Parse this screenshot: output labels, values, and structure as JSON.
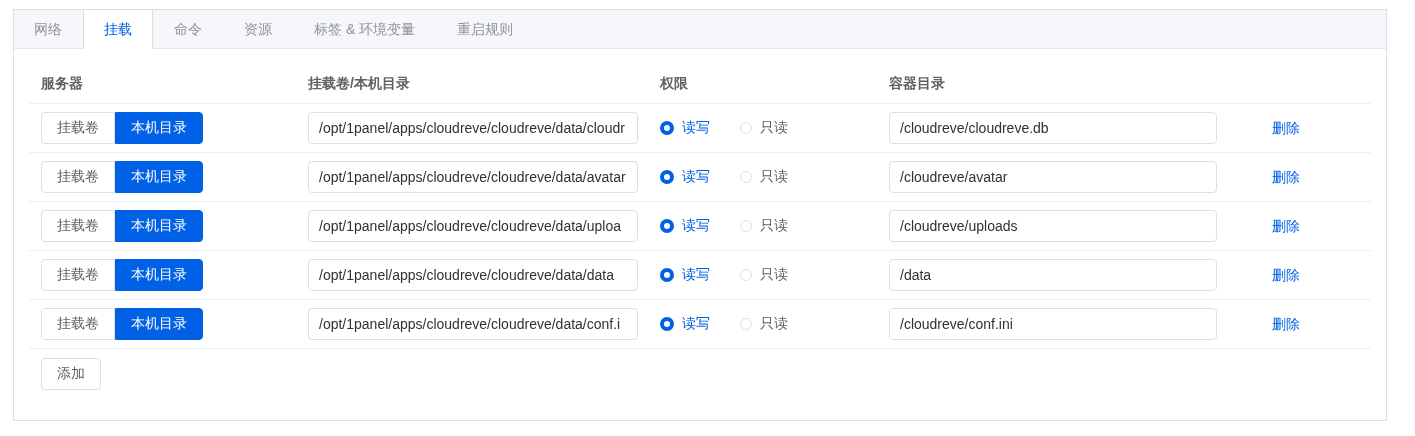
{
  "tabs": [
    {
      "label": "网络",
      "selected": false
    },
    {
      "label": "挂载",
      "selected": true
    },
    {
      "label": "命令",
      "selected": false
    },
    {
      "label": "资源",
      "selected": false
    },
    {
      "label": "标签 & 环境变量",
      "selected": false
    },
    {
      "label": "重启规则",
      "selected": false
    }
  ],
  "table": {
    "columns": [
      "服务器",
      "挂载卷/本机目录",
      "权限",
      "容器目录"
    ],
    "rows": [
      {
        "type_options": [
          {
            "label": "挂载卷",
            "selected": false
          },
          {
            "label": "本机目录",
            "selected": true
          }
        ],
        "source": "/opt/1panel/apps/cloudreve/cloudreve/data/cloudr",
        "permissions": [
          {
            "label": "读写",
            "selected": true
          },
          {
            "label": "只读",
            "selected": false
          }
        ],
        "target": "/cloudreve/cloudreve.db",
        "action": "删除"
      },
      {
        "type_options": [
          {
            "label": "挂载卷",
            "selected": false
          },
          {
            "label": "本机目录",
            "selected": true
          }
        ],
        "source": "/opt/1panel/apps/cloudreve/cloudreve/data/avatar",
        "permissions": [
          {
            "label": "读写",
            "selected": true
          },
          {
            "label": "只读",
            "selected": false
          }
        ],
        "target": "/cloudreve/avatar",
        "action": "删除"
      },
      {
        "type_options": [
          {
            "label": "挂载卷",
            "selected": false
          },
          {
            "label": "本机目录",
            "selected": true
          }
        ],
        "source": "/opt/1panel/apps/cloudreve/cloudreve/data/uploa",
        "permissions": [
          {
            "label": "读写",
            "selected": true
          },
          {
            "label": "只读",
            "selected": false
          }
        ],
        "target": "/cloudreve/uploads",
        "action": "删除"
      },
      {
        "type_options": [
          {
            "label": "挂载卷",
            "selected": false
          },
          {
            "label": "本机目录",
            "selected": true
          }
        ],
        "source": "/opt/1panel/apps/cloudreve/cloudreve/data/data",
        "permissions": [
          {
            "label": "读写",
            "selected": true
          },
          {
            "label": "只读",
            "selected": false
          }
        ],
        "target": "/data",
        "action": "删除"
      },
      {
        "type_options": [
          {
            "label": "挂载卷",
            "selected": false
          },
          {
            "label": "本机目录",
            "selected": true
          }
        ],
        "source": "/opt/1panel/apps/cloudreve/cloudreve/data/conf.i",
        "permissions": [
          {
            "label": "读写",
            "selected": true
          },
          {
            "label": "只读",
            "selected": false
          }
        ],
        "target": "/cloudreve/conf.ini",
        "action": "删除"
      }
    ]
  },
  "add_button": "添加"
}
